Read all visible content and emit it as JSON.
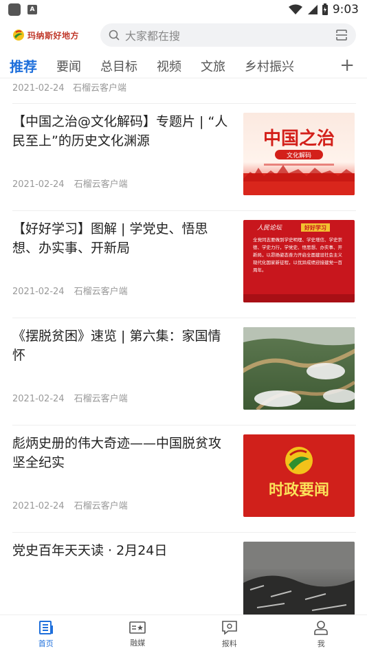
{
  "status_bar": {
    "time": "9:03"
  },
  "header": {
    "logo_text": "玛纳斯好地方",
    "search_placeholder": "大家都在搜"
  },
  "tabs": [
    "推荐",
    "要闻",
    "总目标",
    "视频",
    "文旅",
    "乡村振兴"
  ],
  "partial_item": {
    "date": "2021-02-24",
    "source": "石榴云客户端"
  },
  "articles": [
    {
      "title": "【中国之治@文化解码】专题片 | “人民至上”的历史文化渊源",
      "date": "2021-02-24",
      "source": "石榴云客户端",
      "thumb_title": "中国之治",
      "thumb_sub": "文化解码"
    },
    {
      "title": "【好好学习】图解 | 学党史、悟思想、办实事、开新局",
      "date": "2021-02-24",
      "source": "石榴云客户端",
      "thumb_head_a": "人民论坛",
      "thumb_head_b": "好好学习",
      "thumb_body": "全党同志要做到学史明理、学史增信、学史崇德、学史力行，学党史、悟思想、办实事、开新局，以昂扬姿态奋力开启全面建设社会主义现代化国家新征程，以优异成绩迎接建党一百周年。"
    },
    {
      "title": "《摆脱贫困》速览 | 第六集：家国情怀",
      "date": "2021-02-24",
      "source": "石榴云客户端"
    },
    {
      "title": "彪炳史册的伟大奇迹——中国脱贫攻坚全纪实",
      "date": "2021-02-24",
      "source": "石榴云客户端",
      "thumb_title": "时政要闻"
    },
    {
      "title": "党史百年天天读 · 2月24日",
      "date": "",
      "source": ""
    }
  ],
  "bottom_nav": [
    "首页",
    "融媒",
    "报料",
    "我"
  ],
  "colors": {
    "accent": "#1e6fdb",
    "red": "#d0201b"
  }
}
